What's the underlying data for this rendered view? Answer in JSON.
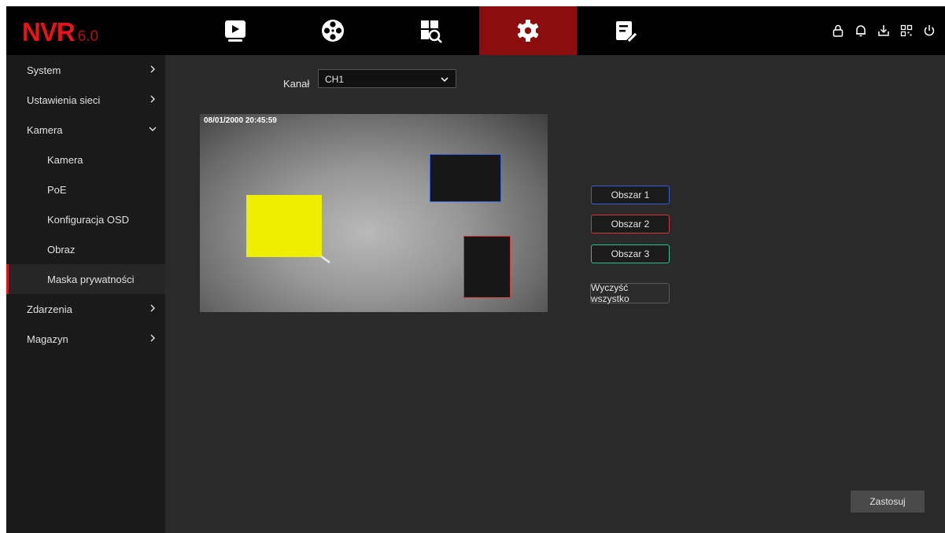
{
  "app": {
    "logo_main": "NVR",
    "logo_version": "6.0"
  },
  "top_nav": {
    "tabs": [
      {
        "icon": "playback-icon"
      },
      {
        "icon": "film-reel-icon"
      },
      {
        "icon": "file-search-icon"
      },
      {
        "icon": "gear-icon",
        "active": true
      },
      {
        "icon": "maintenance-icon"
      }
    ],
    "system_icons": [
      "lock-icon",
      "bell-icon",
      "download-icon",
      "qr-code-icon",
      "power-icon"
    ]
  },
  "sidebar": {
    "items": [
      {
        "label": "System",
        "expanded": false,
        "level": 0
      },
      {
        "label": "Ustawienia sieci",
        "expanded": false,
        "level": 0
      },
      {
        "label": "Kamera",
        "expanded": true,
        "level": 0
      },
      {
        "label": "Kamera",
        "level": 1
      },
      {
        "label": "PoE",
        "level": 1
      },
      {
        "label": "Konfiguracja OSD",
        "level": 1
      },
      {
        "label": "Obraz",
        "level": 1
      },
      {
        "label": "Maska prywatności",
        "level": 1,
        "active": true
      },
      {
        "label": "Zdarzenia",
        "expanded": false,
        "level": 0
      },
      {
        "label": "Magazyn",
        "expanded": false,
        "level": 0
      }
    ]
  },
  "main": {
    "channel_label": "Kanał",
    "channel_value": "CH1",
    "preview": {
      "osd_timestamp": "08/01/2000  20:45:59"
    },
    "masks": [
      {
        "name": "active-area",
        "color": "#eeee00"
      },
      {
        "name": "area-1",
        "border_color": "#3a5fd4"
      },
      {
        "name": "area-2",
        "border_color": "#d23a3a"
      }
    ],
    "area_buttons": [
      {
        "label": "Obszar 1",
        "color": "#3a5fd4"
      },
      {
        "label": "Obszar 2",
        "color": "#d23a3a"
      },
      {
        "label": "Obszar 3",
        "color": "#2fbf8f"
      }
    ],
    "clear_label": "Wyczyść wszystko",
    "apply_label": "Zastosuj"
  },
  "colors": {
    "accent": "#d3181e",
    "active_tab": "#8b0d0d",
    "background": "#2a2a2a",
    "sidebar": "#1a1a1a"
  }
}
